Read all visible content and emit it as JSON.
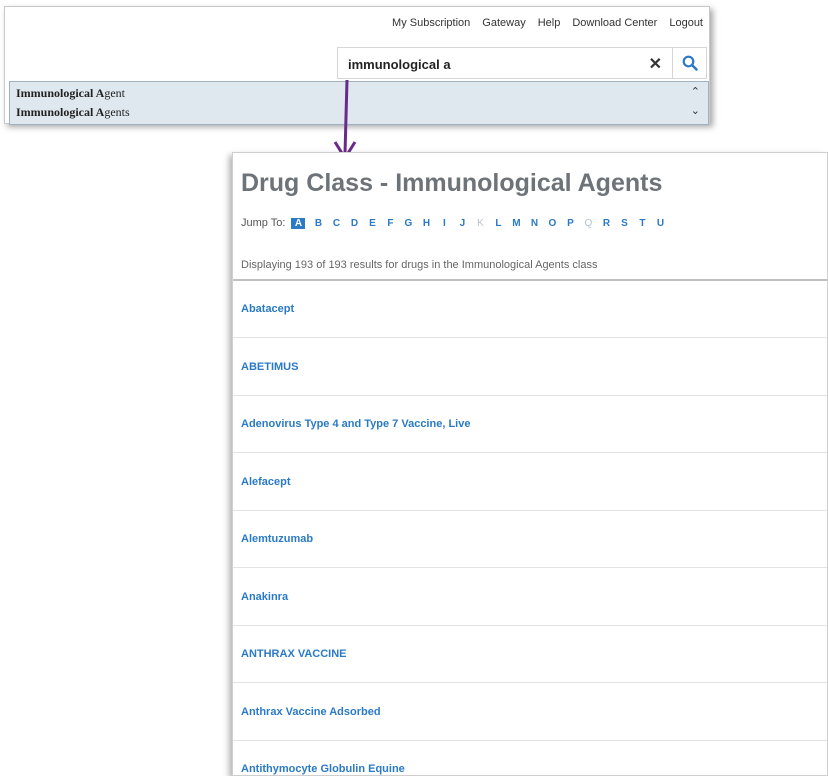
{
  "top_nav": {
    "items": [
      "My Subscription",
      "Gateway",
      "Help",
      "Download Center",
      "Logout"
    ]
  },
  "search": {
    "value": "immunological a",
    "clear_symbol": "✕"
  },
  "suggestions": [
    {
      "bold": "Immunological A",
      "rest": "gent"
    },
    {
      "bold": "Immunological A",
      "rest": "gents"
    }
  ],
  "results": {
    "title": "Drug Class - Immunological Agents",
    "jump_label": "Jump To:",
    "letters": [
      "A",
      "B",
      "C",
      "D",
      "E",
      "F",
      "G",
      "H",
      "I",
      "J",
      "K",
      "L",
      "M",
      "N",
      "O",
      "P",
      "Q",
      "R",
      "S",
      "T",
      "U"
    ],
    "active_letter": "A",
    "disabled_letters": [
      "K",
      "Q"
    ],
    "count_text": "Displaying 193 of 193 results for drugs in the Immunological Agents class",
    "drugs": [
      "Abatacept",
      "ABETIMUS",
      "Adenovirus Type 4 and Type 7 Vaccine, Live",
      "Alefacept",
      "Alemtuzumab",
      "Anakinra",
      "ANTHRAX VACCINE",
      "Anthrax Vaccine Adsorbed",
      "Antithymocyte Globulin Equine"
    ]
  },
  "colors": {
    "link": "#2a7ac7",
    "arrow": "#6a2a8a",
    "suggest_bg": "#dfe8ef",
    "title": "#6d7378"
  }
}
